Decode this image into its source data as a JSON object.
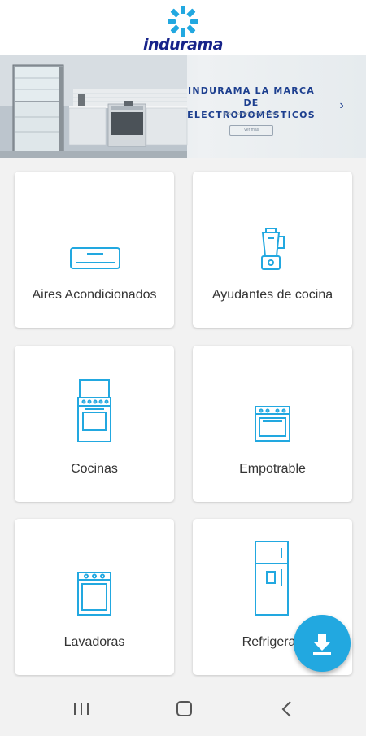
{
  "header": {
    "brand": "indurama",
    "logo_icon": "star-logo-icon"
  },
  "banner": {
    "title_line1": "INDURAMA LA MARCA",
    "title_line2": "DE ELECTRODOMÉSTICOS",
    "subtitle": "Más vendida en Ecuador",
    "button_label": "Ver más",
    "arrow": "›"
  },
  "categories": [
    {
      "label": "Aires Acondicionados",
      "icon": "air-conditioner-icon"
    },
    {
      "label": "Ayudantes de cocina",
      "icon": "blender-icon"
    },
    {
      "label": "Cocinas",
      "icon": "stove-icon"
    },
    {
      "label": "Empotrable",
      "icon": "built-in-oven-icon"
    },
    {
      "label": "Lavadoras",
      "icon": "washer-icon"
    },
    {
      "label": "Refrigerad",
      "icon": "refrigerator-icon"
    }
  ],
  "fab": {
    "icon": "download-icon"
  },
  "navbar": {
    "recent": "recent-apps-icon",
    "home": "home-icon",
    "back": "back-icon"
  },
  "colors": {
    "accent": "#22a8e0",
    "brand_blue": "#17238a",
    "banner_text": "#1d3f8f"
  }
}
